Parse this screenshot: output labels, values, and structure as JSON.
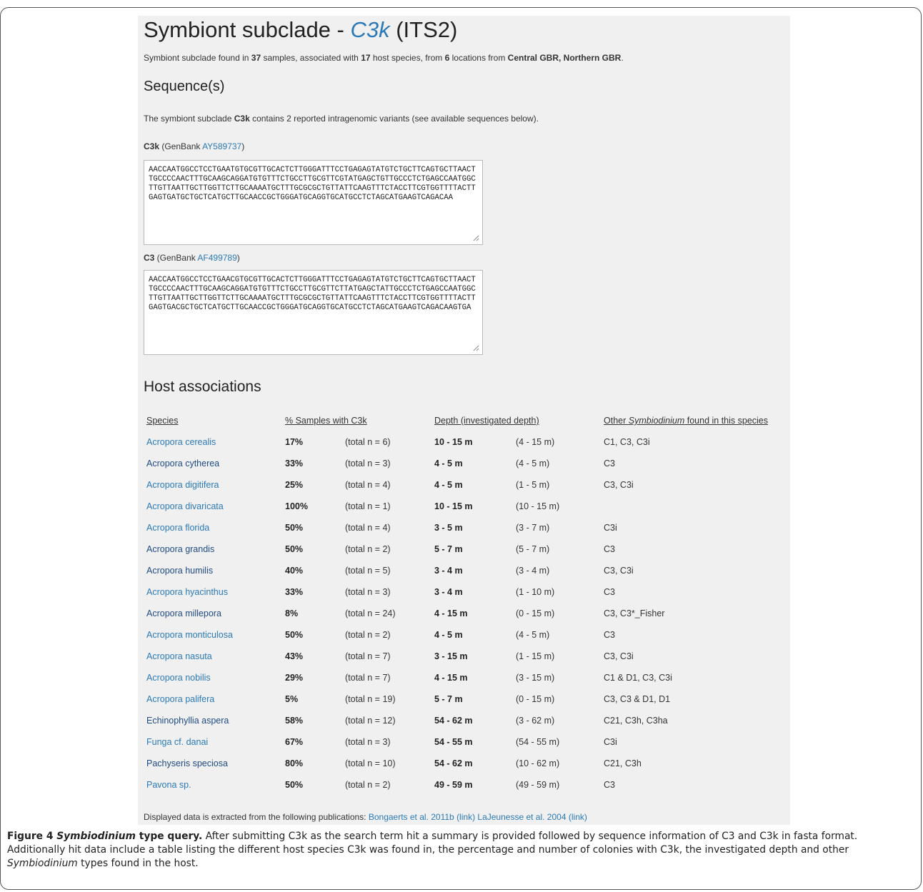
{
  "page": {
    "title_prefix": "Symbiont subclade - ",
    "title_subclade": "C3k",
    "title_suffix": " (ITS2)",
    "summary": {
      "t1": "Symbiont subclade found in ",
      "samples": "37",
      "t2": " samples, associated with ",
      "hosts": "17",
      "t3": " host species, from ",
      "locations": "6",
      "t4": " locations from ",
      "regions": "Central GBR, Northern GBR",
      "t5": "."
    },
    "sequence_heading": "Sequence(s)",
    "sequence_desc": {
      "t1": "The symbiont subclade ",
      "name": "C3k",
      "t2": " contains 2 reported intragenomic variants (see available sequences below)."
    },
    "sequences": [
      {
        "name": "C3k",
        "genbank_prefix": " (GenBank ",
        "accession": "AY589737",
        "suffix": ")",
        "text": "AACCAATGGCCTCCTGAATGTGCGTTGCACTCTTGGGATTTCCTGAGAGTATGTCTGCTTCAGTGCTTAACTTGCCCCAACTTTGCAAGCAGGATGTGTTTCTGCCTTGCGTTCGTATGAGCTGTTGCCCTCTGAGCCAATGGCTTGTTAATTGCTTGGTTCTTGCAAAATGCTTTGCGCGCTGTTATTCAAGTTTCTACCTTCGTGGTTTTACTTGAGTGATGCTGCTCATGCTTGCAACCGCTGGGATGCAGGTGCATGCCTCTAGCATGAAGTCAGACAA"
      },
      {
        "name": "C3",
        "genbank_prefix": " (GenBank ",
        "accession": "AF499789",
        "suffix": ")",
        "text": "AACCAATGGCCTCCTGAACGTGCGTTGCACTCTTGGGATTTCCTGAGAGTATGTCTGCTTCAGTGCTTAACTTGCCCCAACTTTGCAAGCAGGATGTGTTTCTGCCTTGCGTTCTTATGAGCTATTGCCCTCTGAGCCAATGGCTTGTTAATTGCTTGGTTCTTGCAAAATGCTTTGCGCGCTGTTATTCAAGTTTCTACCTTCGTGGTTTTACTTGAGTGACGCTGCTCATGCTTGCAACCGCTGGGATGCAGGTGCATGCCTCTAGCATGAAGTCAGACAAGTGA"
      }
    ],
    "host_heading": "Host associations",
    "table": {
      "headers": {
        "species": "Species",
        "pct": "% Samples with C3k",
        "depth": "Depth (investigated depth)",
        "other_prefix": "Other ",
        "other_genus": "Symbiodinium",
        "other_suffix": " found in this species"
      },
      "rows": [
        {
          "species": "Acropora cerealis",
          "pct": "17%",
          "total": "(total n = 6)",
          "depth": "10 - 15 m",
          "inv": "(4 - 15 m)",
          "other": "C1, C3, C3i",
          "color": "#2b7ab7"
        },
        {
          "species": "Acropora cytherea",
          "pct": "33%",
          "total": "(total n = 3)",
          "depth": "4 - 5 m",
          "inv": "(4 - 5 m)",
          "other": "C3",
          "color": "#1f4a82"
        },
        {
          "species": "Acropora digitifera",
          "pct": "25%",
          "total": "(total n = 4)",
          "depth": "4 - 5 m",
          "inv": "(1 - 5 m)",
          "other": "C3, C3i",
          "color": "#2b7ab7"
        },
        {
          "species": "Acropora divaricata",
          "pct": "100%",
          "total": "(total n = 1)",
          "depth": "10 - 15 m",
          "inv": "(10 - 15 m)",
          "other": "",
          "color": "#2b7ab7"
        },
        {
          "species": "Acropora florida",
          "pct": "50%",
          "total": "(total n = 4)",
          "depth": "3 - 5 m",
          "inv": "(3 - 7 m)",
          "other": "C3i",
          "color": "#2b7ab7"
        },
        {
          "species": "Acropora grandis",
          "pct": "50%",
          "total": "(total n = 2)",
          "depth": "5 - 7 m",
          "inv": "(5 - 7 m)",
          "other": "C3",
          "color": "#1f4a82"
        },
        {
          "species": "Acropora humilis",
          "pct": "40%",
          "total": "(total n = 5)",
          "depth": "3 - 4 m",
          "inv": "(3 - 4 m)",
          "other": "C3, C3i",
          "color": "#1f4a82"
        },
        {
          "species": "Acropora hyacinthus",
          "pct": "33%",
          "total": "(total n = 3)",
          "depth": "3 - 4 m",
          "inv": "(1 - 10 m)",
          "other": "C3",
          "color": "#2b7ab7"
        },
        {
          "species": "Acropora millepora",
          "pct": "8%",
          "total": "(total n = 24)",
          "depth": "4 - 15 m",
          "inv": "(0 - 15 m)",
          "other": "C3, C3*_Fisher",
          "color": "#1f4a82"
        },
        {
          "species": "Acropora monticulosa",
          "pct": "50%",
          "total": "(total n = 2)",
          "depth": "4 - 5 m",
          "inv": "(4 - 5 m)",
          "other": "C3",
          "color": "#2b7ab7"
        },
        {
          "species": "Acropora nasuta",
          "pct": "43%",
          "total": "(total n = 7)",
          "depth": "3 - 15 m",
          "inv": "(1 - 15 m)",
          "other": "C3, C3i",
          "color": "#2b7ab7"
        },
        {
          "species": "Acropora nobilis",
          "pct": "29%",
          "total": "(total n = 7)",
          "depth": "4 - 15 m",
          "inv": "(3 - 15 m)",
          "other": "C1 & D1, C3, C3i",
          "color": "#2b7ab7"
        },
        {
          "species": "Acropora palifera",
          "pct": "5%",
          "total": "(total n = 19)",
          "depth": "5 - 7 m",
          "inv": "(0 - 15 m)",
          "other": "C3, C3 & D1, D1",
          "color": "#2b7ab7"
        },
        {
          "species": "Echinophyllia aspera",
          "pct": "58%",
          "total": "(total n = 12)",
          "depth": "54 - 62 m",
          "inv": "(3 - 62 m)",
          "other": "C21, C3h, C3ha",
          "color": "#1f4a82"
        },
        {
          "species": "Funga cf. danai",
          "pct": "67%",
          "total": "(total n = 3)",
          "depth": "54 - 55 m",
          "inv": "(54 - 55 m)",
          "other": "C3i",
          "color": "#2b7ab7"
        },
        {
          "species": "Pachyseris speciosa",
          "pct": "80%",
          "total": "(total n = 10)",
          "depth": "54 - 62 m",
          "inv": "(10 - 62 m)",
          "other": "C21, C3h",
          "color": "#1f4a82"
        },
        {
          "species": "Pavona sp.",
          "pct": "50%",
          "total": "(total n = 2)",
          "depth": "49 - 59 m",
          "inv": "(49 - 59 m)",
          "other": "C3",
          "color": "#2b7ab7"
        }
      ]
    },
    "footer": {
      "t1": "Displayed data is extracted from the following publications: ",
      "pub1": "Bongaerts et al. 2011b",
      "link1": "(link)",
      "pub2": "LaJeunesse et al. 2004",
      "link2": "(link)"
    }
  },
  "caption": {
    "label": "Figure 4 ",
    "label_italic": "Symbiodinium",
    "label_rest": " type query.",
    "t1": " After submitting C3k as the search term hit a summary is provided followed by sequence information of C3 and C3k in fasta format. Additionally hit data include a table listing the different host species C3k was found in, the percentage and number of colonies with C3k, the investigated depth and other ",
    "italic2": "Symbiodinium",
    "t2": " types found in the host."
  },
  "colors": {
    "link": "#2b7ab7",
    "panel_bg": "#f0f0f0"
  }
}
